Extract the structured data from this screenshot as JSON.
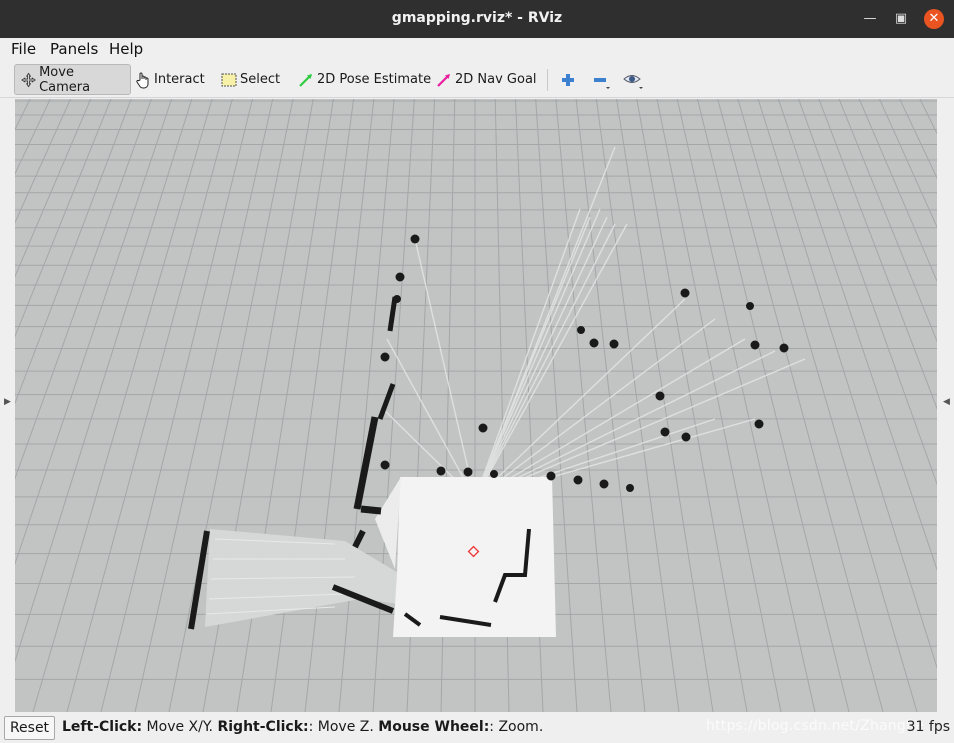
{
  "window": {
    "title": "gmapping.rviz* - RViz"
  },
  "menu": {
    "file": "File",
    "panels": "Panels",
    "help": "Help"
  },
  "toolbar": {
    "move_camera": "Move Camera",
    "interact": "Interact",
    "select": "Select",
    "pose_estimate": "2D Pose Estimate",
    "nav_goal": "2D Nav Goal",
    "icons": [
      "plus-icon",
      "minus-icon",
      "eye-icon"
    ]
  },
  "status": {
    "reset": "Reset",
    "left_click_label": "Left-Click:",
    "left_click_action": " Move X/Y. ",
    "right_click_label": "Right-Click:",
    "right_click_action": ": Move Z. ",
    "wheel_label": "Mouse Wheel:",
    "wheel_action": ": Zoom.",
    "fps": "31 fps",
    "watermark": "https://blog.csdn.net/ZhangRe"
  },
  "colors": {
    "titlebar": "#2f2f2f",
    "close": "#e95420",
    "grid_background": "#c2c4c4",
    "grid_lines": "#9fa3a3",
    "free_space": "#f2f2f2",
    "obstacle": "#1a1a1a",
    "pose_arrow": "#2ecc40",
    "goal_arrow": "#e91ea0"
  }
}
